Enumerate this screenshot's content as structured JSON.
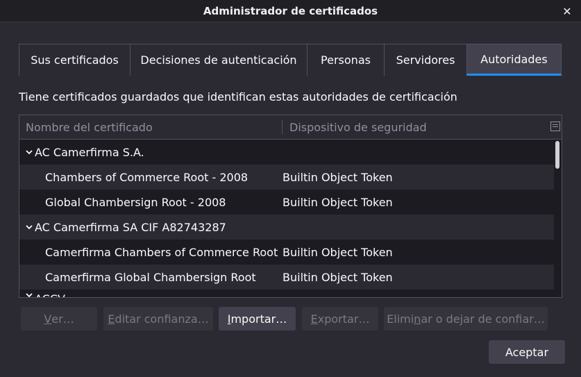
{
  "window": {
    "title": "Administrador de certificados",
    "close_glyph": "✕"
  },
  "tabs": [
    {
      "label": "Sus certificados",
      "active": false
    },
    {
      "label": "Decisiones de autenticación",
      "active": false
    },
    {
      "label": "Personas",
      "active": false
    },
    {
      "label": "Servidores",
      "active": false
    },
    {
      "label": "Autoridades",
      "active": true
    }
  ],
  "intro_text": "Tiene certificados guardados que identifican estas autoridades de certificación",
  "tree": {
    "columns": {
      "name": "Nombre del certificado",
      "device": "Dispositivo de seguridad"
    },
    "groups": [
      {
        "name": "AC Camerfirma S.A.",
        "expanded": true,
        "items": [
          {
            "name": "Chambers of Commerce Root - 2008",
            "device": "Builtin Object Token"
          },
          {
            "name": "Global Chambersign Root - 2008",
            "device": "Builtin Object Token"
          }
        ]
      },
      {
        "name": "AC Camerfirma SA CIF A82743287",
        "expanded": true,
        "items": [
          {
            "name": "Camerfirma Chambers of Commerce Root",
            "device": "Builtin Object Token"
          },
          {
            "name": "Camerfirma Global Chambersign Root",
            "device": "Builtin Object Token"
          }
        ]
      }
    ],
    "partial_row": "ACCV"
  },
  "buttons": {
    "view": {
      "pre": "",
      "mnemonic": "V",
      "post": "er…",
      "enabled": false
    },
    "edit": {
      "pre": "",
      "mnemonic": "E",
      "post": "ditar confianza…",
      "enabled": false
    },
    "import": {
      "pre": "",
      "mnemonic": "I",
      "post": "mportar…",
      "enabled": true
    },
    "export": {
      "pre": "",
      "mnemonic": "E",
      "post": "xportar…",
      "enabled": false
    },
    "delete": {
      "pre": "Elimi",
      "mnemonic": "n",
      "post": "ar o dejar de confiar…",
      "enabled": false
    },
    "accept": "Aceptar"
  },
  "colors": {
    "background": "#2b2a33",
    "active_tab_underline": "#1e90ff"
  }
}
